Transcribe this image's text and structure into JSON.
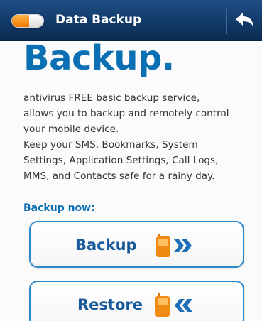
{
  "header": {
    "title": "Data Backup",
    "menu_icon": "toggle-pill-icon",
    "back_icon": "back-arrow-icon"
  },
  "main": {
    "heading": "Backup.",
    "description_lines": [
      "antivirus FREE basic backup service,",
      "allows you to backup and remotely control",
      "your mobile device.",
      "Keep your SMS, Bookmarks, System",
      "Settings, Application Settings, Call Logs,",
      "MMS, and Contacts safe for a rainy day."
    ],
    "section_label": "Backup now:",
    "buttons": [
      {
        "label": "Backup",
        "icon": "phone-forward-icon"
      },
      {
        "label": "Restore",
        "icon": "phone-rewind-icon"
      }
    ]
  },
  "colors": {
    "header_bg": "#123a68",
    "accent_blue": "#0b6fb3",
    "button_border": "#2d89cc",
    "icon_orange": "#f08a12"
  }
}
